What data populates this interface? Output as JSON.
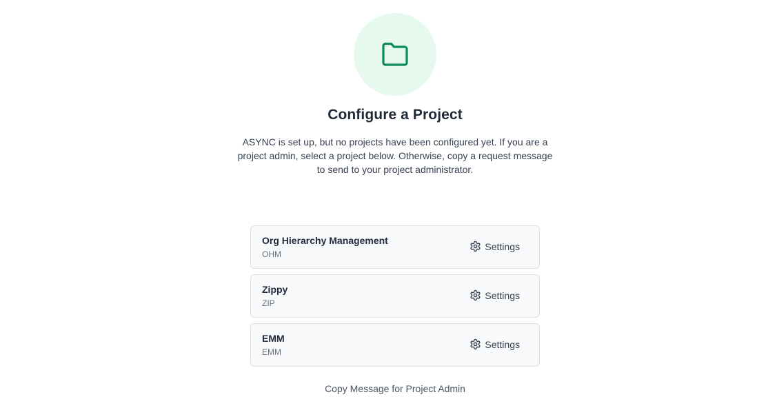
{
  "hero": {
    "icon": "folder-icon",
    "circle_color": "#e6f9ef",
    "icon_color": "#0e8a5f"
  },
  "title": "Configure a Project",
  "description": "ASYNC is set up, but no projects have been configured yet. If you are a project admin, select a project below. Otherwise, copy a request message to send to your project administrator.",
  "projects": [
    {
      "name": "Org Hierarchy Management",
      "key": "OHM",
      "settings_label": "Settings"
    },
    {
      "name": "Zippy",
      "key": "ZIP",
      "settings_label": "Settings"
    },
    {
      "name": "EMM",
      "key": "EMM",
      "settings_label": "Settings"
    }
  ],
  "copy_link_label": "Copy Message for Project Admin"
}
